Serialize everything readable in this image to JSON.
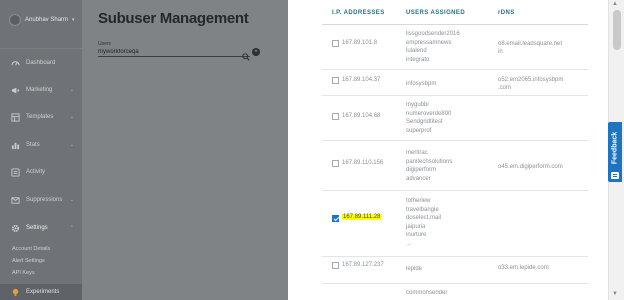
{
  "sidebar": {
    "user_name": "Anubhav Sharm",
    "items": [
      {
        "label": "Dashboard",
        "icon": "dashboard-icon",
        "has_caret": false
      },
      {
        "label": "Marketing",
        "icon": "megaphone-icon",
        "has_caret": true
      },
      {
        "label": "Templates",
        "icon": "template-icon",
        "has_caret": true
      },
      {
        "label": "Stats",
        "icon": "stats-icon",
        "has_caret": true
      },
      {
        "label": "Activity",
        "icon": "activity-icon",
        "has_caret": false
      },
      {
        "label": "Suppressions",
        "icon": "suppression-icon",
        "has_caret": true
      },
      {
        "label": "Settings",
        "icon": "gear-icon",
        "has_caret": true
      }
    ],
    "settings_links": [
      "Account Details",
      "Alert Settings",
      "API Keys"
    ],
    "experiments_label": "Experiments"
  },
  "main": {
    "title": "Subuser Management",
    "search_label": "Users",
    "search_value": "myworkforceqa"
  },
  "panel": {
    "columns": [
      "I.P. ADDRESSES",
      "USERS ASSIGNED",
      "rDNS"
    ],
    "rows": [
      {
        "checked": false,
        "highlighted": false,
        "ip": "167.89.101.8",
        "users": [
          "lissgoodsender2016",
          "empressamnews",
          "lulalend",
          "integrato"
        ],
        "rdns": [
          "o8.email.leadsquare.net",
          "in"
        ]
      },
      {
        "checked": false,
        "highlighted": false,
        "ip": "167.89.104.37",
        "users": [
          "infosysbpm"
        ],
        "rdns": [
          "o52.em2065.infosysbpm",
          ".com"
        ]
      },
      {
        "checked": false,
        "highlighted": false,
        "ip": "167.89.104.68",
        "users": [
          "mygubbi",
          "numeroverde800",
          "Sendgridtitest",
          "superprof"
        ],
        "rdns": []
      },
      {
        "checked": false,
        "highlighted": false,
        "ip": "167.89.110.156",
        "users": [
          "meritrac",
          "panitechsolutions",
          "digiperform",
          "advancer"
        ],
        "rdns": [
          "o45.em.digiperform.com"
        ]
      },
      {
        "checked": true,
        "highlighted": true,
        "ip": "167.89.111.28",
        "users": [
          "totherlew",
          "travelbangie",
          "doselect.mail",
          "jaipuria",
          "inurture",
          "..."
        ],
        "rdns": []
      },
      {
        "checked": false,
        "highlighted": false,
        "ip": "167.89.127.237",
        "users": [
          "lepide"
        ],
        "rdns": [
          "o33.em.lepide.com"
        ]
      },
      {
        "checked": false,
        "highlighted": false,
        "ip": "",
        "users": [
          "commonsender"
        ],
        "rdns": []
      }
    ]
  },
  "feedback_label": "Feedback",
  "colors": {
    "accent": "#1d74c2",
    "header_text": "#2a6f83",
    "highlight": "#ffff00"
  }
}
